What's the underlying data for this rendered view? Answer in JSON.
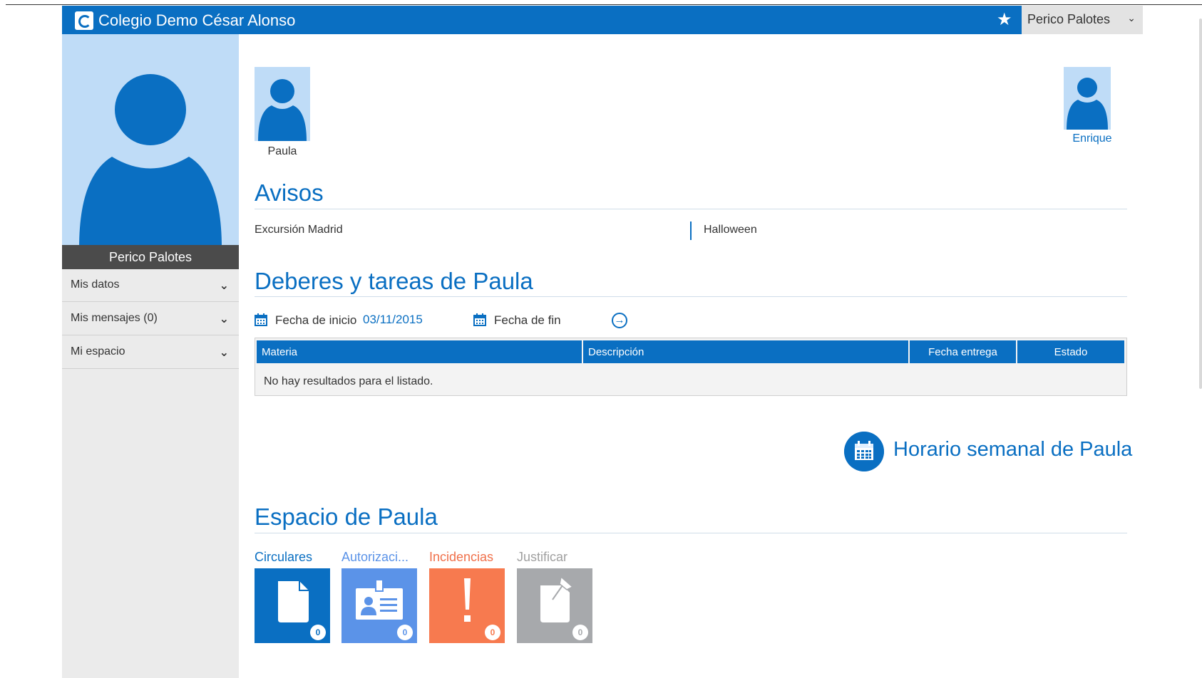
{
  "app": {
    "title": "Colegio Demo César Alonso"
  },
  "header": {
    "user_select": "Perico Palotes"
  },
  "sidebar": {
    "profile_name": "Perico Palotes",
    "items": [
      {
        "label": "Mis datos"
      },
      {
        "label": "Mis mensajes (0)"
      },
      {
        "label": "Mi espacio"
      }
    ]
  },
  "children": [
    {
      "name": "Paula"
    },
    {
      "name": "Enrique"
    }
  ],
  "avisos": {
    "title": "Avisos",
    "items": [
      "Excursión Madrid",
      "Halloween"
    ]
  },
  "deberes": {
    "title": "Deberes y tareas de Paula",
    "start_label": "Fecha de inicio",
    "start_value": "03/11/2015",
    "end_label": "Fecha de fin",
    "end_value": "",
    "columns": [
      "Materia",
      "Descripción",
      "Fecha entrega",
      "Estado"
    ],
    "empty_message": "No hay resultados para el listado."
  },
  "horario": {
    "label": "Horario semanal de Paula"
  },
  "espacio": {
    "title": "Espacio de Paula",
    "tiles": [
      {
        "label": "Circulares",
        "count": "0",
        "color": "#0a6fc2",
        "label_color": "#0a6fc2",
        "icon": "document-icon"
      },
      {
        "label": "Autorizaci...",
        "count": "0",
        "color": "#5b93e8",
        "label_color": "#5b93e8",
        "icon": "id-card-icon"
      },
      {
        "label": "Incidencias",
        "count": "0",
        "color": "#f77a4f",
        "label_color": "#f0704a",
        "icon": "exclamation-icon"
      },
      {
        "label": "Justificar",
        "count": "0",
        "color": "#a7a9ac",
        "label_color": "#a0a0a0",
        "icon": "pinned-note-icon"
      }
    ]
  }
}
